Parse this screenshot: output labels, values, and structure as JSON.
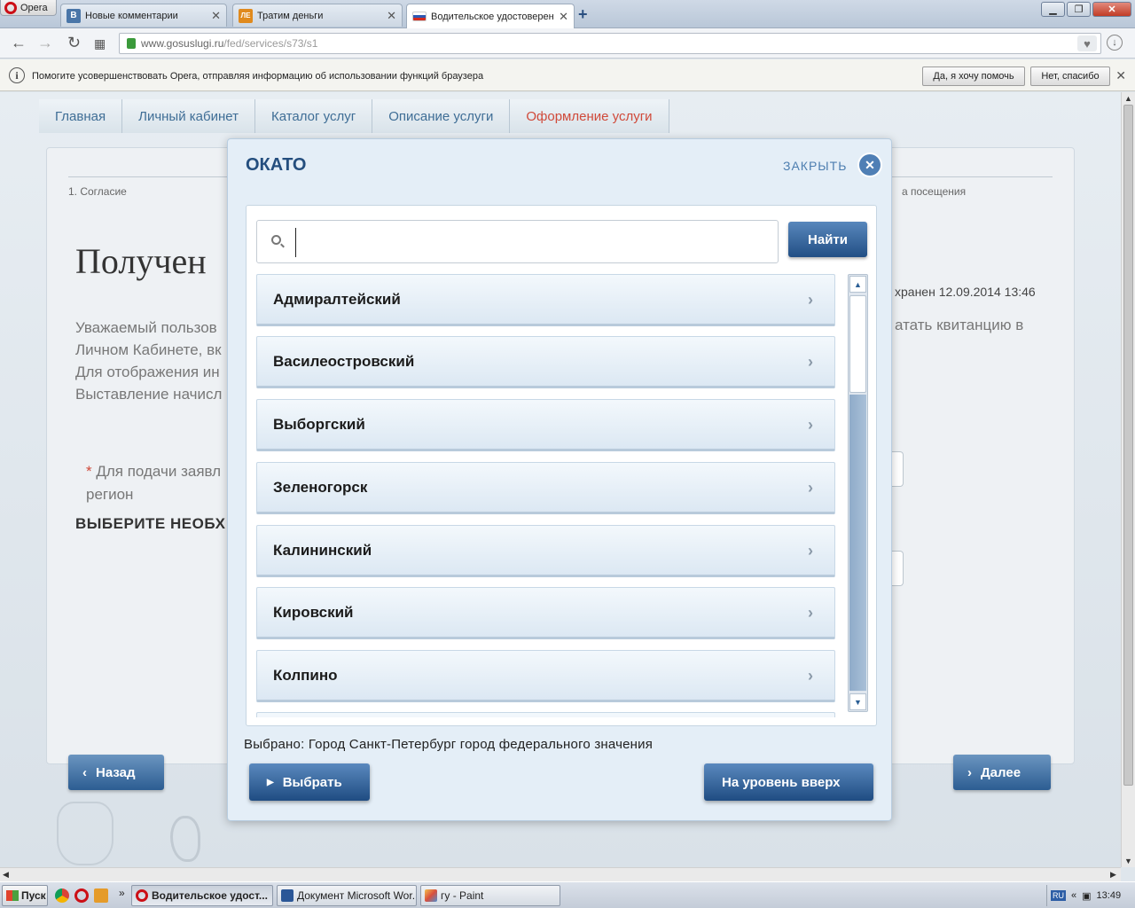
{
  "browser": {
    "app_label": "Opera",
    "tabs": [
      {
        "label": "Новые комментарии",
        "favicon": "vk-icon",
        "favicon_text": "B"
      },
      {
        "label": "Тратим деньги",
        "favicon": "lj-icon",
        "favicon_text": "ЛЕ"
      },
      {
        "label": "Водительское удостоверение",
        "favicon": "russia-flag-icon",
        "favicon_text": ""
      }
    ],
    "new_tab": "+",
    "url_host": "www.gosuslugi.ru",
    "url_path": "/fed/services/s73/s1",
    "window_buttons": {
      "minimize": "▁",
      "maximize": "❐",
      "close": "✕"
    }
  },
  "infobar": {
    "message": "Помогите усовершенствовать Opera, отправляя информацию об использовании функций браузера",
    "accept": "Да, я хочу помочь",
    "decline": "Нет, спасибо",
    "close": "✕"
  },
  "page": {
    "breadcrumbs": [
      "Главная",
      "Личный кабинет",
      "Каталог услуг",
      "Описание услуги",
      "Оформление услуги"
    ],
    "step_first": "1. Согласие",
    "step_last_partial": "а посещения",
    "title_partial": "Получен",
    "saved_partial": "хранен 12.09.2014 13:46",
    "para_lines": [
      "Уважаемый пользов",
      "Личном Кабинете, вк",
      "Для отображения ин",
      "Выставление начисл"
    ],
    "para_right": "атать квитанцию в",
    "required_star": "*",
    "required_line1": "Для подачи заявл",
    "required_line2": "регион",
    "choose_partial": "ВЫБЕРИТЕ НЕОБХ",
    "back_button": "Назад",
    "next_button": "Далее"
  },
  "dialog": {
    "title": "ОКАТО",
    "close_label": "ЗАКРЫТЬ",
    "search_value": "",
    "find_button": "Найти",
    "items": [
      "Адмиралтейский",
      "Василеостровский",
      "Выборгский",
      "Зеленогорск",
      "Калининский",
      "Кировский",
      "Колпино"
    ],
    "selected_label": "Выбрано:",
    "selected_value": "Город Санкт-Петербург город федерального значения",
    "select_button": "Выбрать",
    "level_up_button": "На уровень вверх"
  },
  "taskbar": {
    "start": "Пуск",
    "more": "»",
    "tasks": [
      {
        "label": "Водительское удост...",
        "icon": "opera-icon"
      },
      {
        "label": "Документ Microsoft Wor...",
        "icon": "word-icon"
      },
      {
        "label": "гу - Paint",
        "icon": "paint-icon"
      }
    ],
    "lang": "RU",
    "tray_more": "«",
    "time": "13:49"
  },
  "colors": {
    "accent_blue": "#2c5d92",
    "active_crumb": "#d04a3a",
    "dialog_bg": "#e4eef7"
  }
}
